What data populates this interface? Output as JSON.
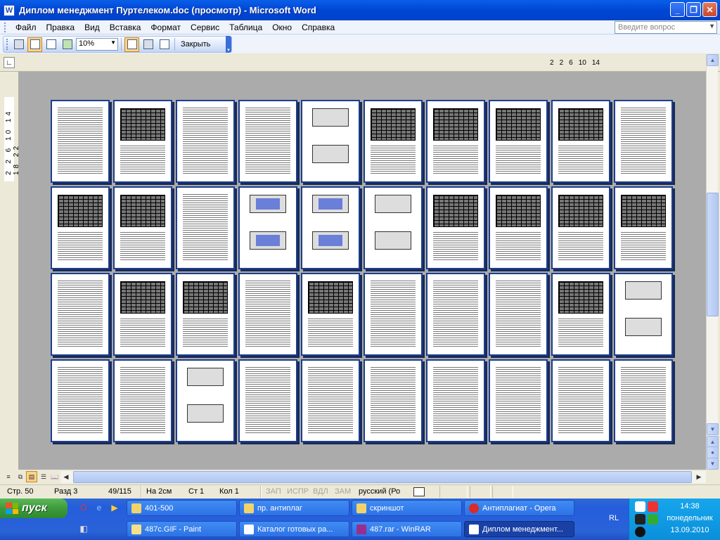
{
  "window": {
    "app_icon": "word-icon",
    "title": "Диплом менеджмент Пуртелеком.doc (просмотр) - Microsoft Word",
    "minimize": "_",
    "maximize": "❐",
    "close": "✕"
  },
  "menu": {
    "items": [
      "Файл",
      "Правка",
      "Вид",
      "Вставка",
      "Формат",
      "Сервис",
      "Таблица",
      "Окно",
      "Справка"
    ],
    "help_placeholder": "Введите вопрос"
  },
  "toolbar": {
    "zoom": "10%",
    "close_label": "Закрыть"
  },
  "ruler": {
    "h_marks": [
      "2",
      "2",
      "6",
      "10",
      "14"
    ],
    "v_marks": "2 2 6 10 14 18 22"
  },
  "statusbar": {
    "page": "Стр. 50",
    "section": "Разд 3",
    "pages": "49/115",
    "at": "На 2см",
    "line": "Ст 1",
    "col": "Кол 1",
    "rec": "ЗАП",
    "trk": "ИСПР",
    "ext": "ВДЛ",
    "ovr": "ЗАМ",
    "language": "русский (Ро"
  },
  "taskbar": {
    "start": "пуск",
    "tasks_row1": [
      "401-500",
      "пр. антиплаг",
      "скриншот",
      "Антиплагиат - Opera"
    ],
    "tasks_row2": [
      "487c.GIF - Paint",
      "Каталог готовых ра...",
      "487.rar - WinRAR",
      "Диплом менеджмент..."
    ],
    "lang": "RL",
    "time": "14:38",
    "weekday": "понедельник",
    "date": "13.09.2010"
  },
  "colors": {
    "titlebar": "#0A5FE8",
    "page_border": "#1C3E8F",
    "doc_bg": "#ABABAB",
    "taskbar": "#245EDB",
    "start": "#3C9A3B"
  }
}
